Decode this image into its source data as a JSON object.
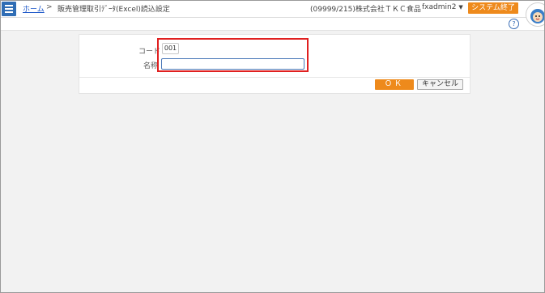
{
  "header": {
    "breadcrumb_home": "ホーム",
    "breadcrumb_separator": ">",
    "page_title": "販売管理取引ﾃﾞｰﾀ(Excel)読込設定",
    "company": "(09999/215)株式会社ＴＫＣ食品",
    "user": "fxadmin2",
    "user_caret": "▼",
    "exit_label": "システム終了",
    "help_icon": "?"
  },
  "form": {
    "code_label": "コード",
    "code_value": "001",
    "name_label": "名称",
    "name_value": ""
  },
  "footer": {
    "ok_label": "ＯＫ",
    "cancel_label": "キャンセル"
  },
  "colors": {
    "accent_orange": "#ee8a1c",
    "menu_blue": "#2f6db5",
    "highlight_red": "#e02020"
  }
}
